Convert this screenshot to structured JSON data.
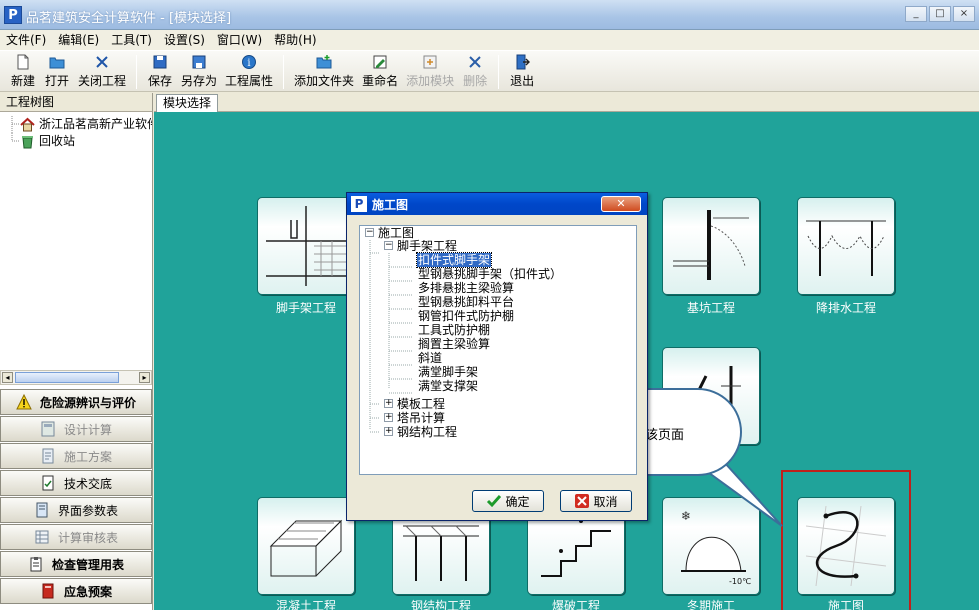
{
  "window": {
    "title": "品茗建筑安全计算软件 - [模块选择]",
    "logo": "P"
  },
  "menu": [
    "文件(F)",
    "编辑(E)",
    "工具(T)",
    "设置(S)",
    "窗口(W)",
    "帮助(H)"
  ],
  "toolbar": {
    "new": "新建",
    "open": "打开",
    "close_project": "关闭工程",
    "save": "保存",
    "save_as": "另存为",
    "project_props": "工程属性",
    "add_folder": "添加文件夹",
    "rename": "重命名",
    "add_module": "添加模块",
    "delete": "删除",
    "exit": "退出"
  },
  "left_panel": {
    "title": "工程树图",
    "tree": [
      "浙江品茗高新产业软件",
      "回收站"
    ],
    "buttons": [
      "危险源辨识与评价",
      "设计计算",
      "施工方案",
      "技术交底",
      "界面参数表",
      "计算审核表",
      "检查管理用表",
      "应急预案"
    ]
  },
  "tab": {
    "label": "模块选择"
  },
  "modules": {
    "scaffold": "脚手架工程",
    "pit": "基坑工程",
    "dewater": "降排水工程",
    "concrete": "混凝土工程",
    "steel": "钢结构工程",
    "blast": "爆破工程",
    "winter": "冬期施工",
    "drawing": "施工图"
  },
  "callout": {
    "text": "单击进入该页面"
  },
  "dialog": {
    "title": "施工图",
    "root": "施工图",
    "group1": "脚手架工程",
    "items": [
      "扣件式脚手架",
      "型钢悬挑脚手架（扣件式）",
      "多排悬挑主梁验算",
      "型钢悬挑卸料平台",
      "钢管扣件式防护棚",
      "工具式防护棚",
      "搁置主梁验算",
      "斜道",
      "满堂脚手架",
      "满堂支撑架"
    ],
    "collapsed_groups": [
      "模板工程",
      "塔吊计算",
      "钢结构工程"
    ],
    "ok": "确定",
    "cancel": "取消"
  },
  "colors": {
    "accent": "#20a39a",
    "selection": "#316ac5",
    "highlight": "#c0201b"
  }
}
